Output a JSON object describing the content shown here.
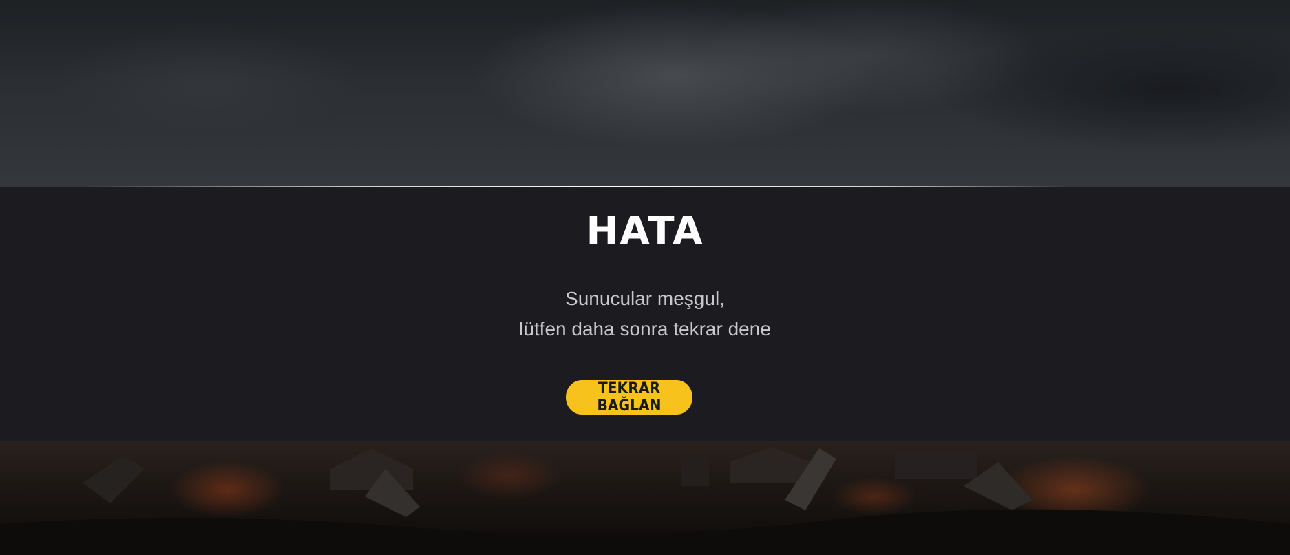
{
  "error_dialog": {
    "title": "HATA",
    "message_line1": "Sunucular meşgul,",
    "message_line2": "lütfen daha sonra tekrar dene",
    "reconnect_label": "TEKRAR BAĞLAN"
  },
  "colors": {
    "panel_bg": "#1c1b1f",
    "title": "#ffffff",
    "message": "#c9c9cc",
    "button_bg": "#f6c21b",
    "button_text": "#1a1a1a"
  }
}
